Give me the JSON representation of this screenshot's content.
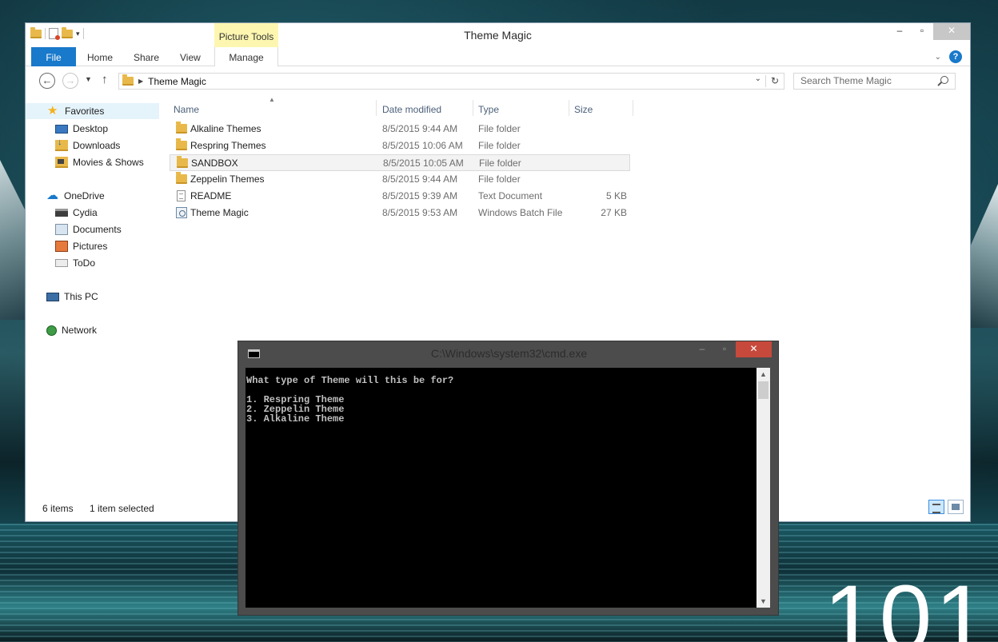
{
  "explorer": {
    "title": "Theme Magic",
    "contextual_tab_group": "Picture Tools",
    "tabs": [
      "File",
      "Home",
      "Share",
      "View",
      "Manage"
    ],
    "address": "Theme Magic",
    "search_placeholder": "Search Theme Magic",
    "nav_pane": {
      "groups": [
        {
          "label": "Favorites",
          "icon": "star-icon",
          "items": [
            {
              "label": "Desktop",
              "icon": "desktop-icon"
            },
            {
              "label": "Downloads",
              "icon": "downloads-icon"
            },
            {
              "label": "Movies & Shows",
              "icon": "movies-folder-icon"
            }
          ]
        },
        {
          "label": "OneDrive",
          "icon": "cloud-icon",
          "items": [
            {
              "label": "Cydia",
              "icon": "cydia-folder-icon"
            },
            {
              "label": "Documents",
              "icon": "documents-icon"
            },
            {
              "label": "Pictures",
              "icon": "pictures-icon"
            },
            {
              "label": "ToDo",
              "icon": "todo-folder-icon"
            }
          ]
        },
        {
          "label": "This PC",
          "icon": "computer-icon",
          "items": []
        },
        {
          "label": "Network",
          "icon": "network-icon",
          "items": []
        }
      ]
    },
    "columns": {
      "name": "Name",
      "date": "Date modified",
      "type": "Type",
      "size": "Size"
    },
    "files": [
      {
        "name": "Alkaline Themes",
        "date": "8/5/2015 9:44 AM",
        "type": "File folder",
        "size": "",
        "icon": "folder-icon"
      },
      {
        "name": "Respring Themes",
        "date": "8/5/2015 10:06 AM",
        "type": "File folder",
        "size": "",
        "icon": "folder-icon"
      },
      {
        "name": "SANDBOX",
        "date": "8/5/2015 10:05 AM",
        "type": "File folder",
        "size": "",
        "icon": "folder-icon",
        "selected": true
      },
      {
        "name": "Zeppelin Themes",
        "date": "8/5/2015 9:44 AM",
        "type": "File folder",
        "size": "",
        "icon": "folder-icon"
      },
      {
        "name": "README",
        "date": "8/5/2015 9:39 AM",
        "type": "Text Document",
        "size": "5 KB",
        "icon": "text-file-icon"
      },
      {
        "name": "Theme Magic",
        "date": "8/5/2015 9:53 AM",
        "type": "Windows Batch File",
        "size": "27 KB",
        "icon": "batch-file-icon"
      }
    ],
    "status": {
      "count": "6 items",
      "selection": "1 item selected"
    },
    "colors": {
      "file_tab": "#1979ca",
      "picture_tools": "#fdf6b0",
      "selection": "#e5f3fb"
    }
  },
  "cmd": {
    "title": "C:\\Windows\\system32\\cmd.exe",
    "lines": [
      "What type of Theme will this be for?",
      "",
      "1. Respring Theme",
      "2. Zeppelin Theme",
      "3. Alkaline Theme"
    ],
    "colors": {
      "close": "#c7493c",
      "console_bg": "#000000",
      "console_text": "#c0c0c0"
    }
  },
  "desktop": {
    "clock_fragment": "101"
  }
}
